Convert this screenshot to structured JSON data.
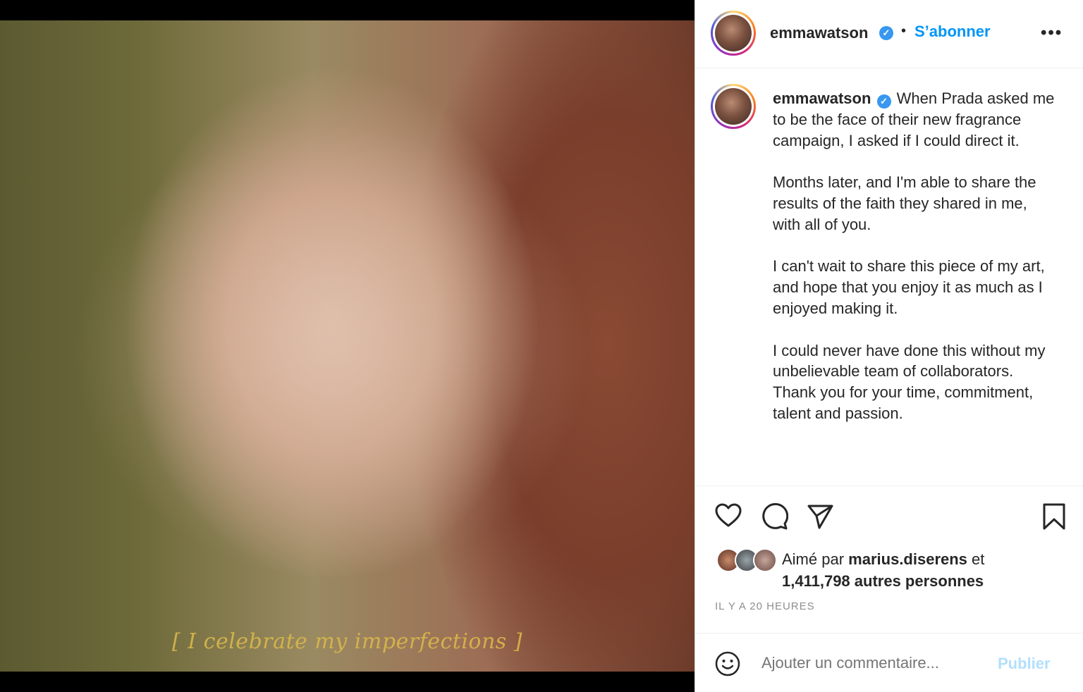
{
  "media": {
    "subtitle": "[ I celebrate my imperfections ]"
  },
  "header": {
    "username": "emmawatson",
    "separator": "•",
    "follow_label": "S’abonner",
    "more_label": "•••"
  },
  "caption": {
    "username": "emmawatson",
    "paragraphs": [
      "When Prada asked me to be the face of their new fragrance campaign, I asked if I could direct it.",
      "Months later, and I'm able to share the results of the faith they shared in me, with all of you.",
      "I can't wait to share this piece of my art, and hope that you enjoy it as much as I enjoyed making it.",
      "I could never have done this without my unbelievable team of collaborators. Thank you for your time, commitment, talent and passion."
    ]
  },
  "actions": {
    "like_icon": "heart-icon",
    "comment_icon": "comment-icon",
    "share_icon": "paper-plane-icon",
    "save_icon": "bookmark-icon"
  },
  "likes": {
    "prefix": "Aimé par",
    "user": "marius.diserens",
    "joiner": "et",
    "count_text": "1,411,798 autres personnes"
  },
  "timestamp": "IL Y A 20 HEURES",
  "comment": {
    "emoji_icon": "smiley-icon",
    "placeholder": "Ajouter un commentaire...",
    "publish_label": "Publier"
  },
  "colors": {
    "accent": "#0095f6",
    "verified": "#3897f0",
    "publish_disabled": "#b2dffc"
  }
}
